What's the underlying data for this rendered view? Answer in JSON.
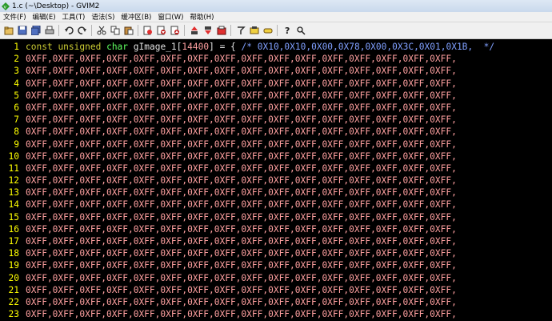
{
  "window": {
    "title": "1.c (~\\Desktop) - GVIM2"
  },
  "menu": [
    "文件(F)",
    "编辑(E)",
    "工具(T)",
    "语法(S)",
    "缓冲区(B)",
    "窗口(W)",
    "帮助(H)"
  ],
  "toolbar": [
    {
      "name": "open-icon"
    },
    {
      "name": "save-icon"
    },
    {
      "name": "save-all-icon"
    },
    {
      "name": "print-icon"
    },
    {
      "sep": true
    },
    {
      "name": "undo-icon"
    },
    {
      "name": "redo-icon"
    },
    {
      "sep": true
    },
    {
      "name": "cut-icon"
    },
    {
      "name": "copy-icon"
    },
    {
      "name": "paste-icon"
    },
    {
      "sep": true
    },
    {
      "name": "find-replace-icon"
    },
    {
      "name": "find-next-icon"
    },
    {
      "name": "find-prev-icon"
    },
    {
      "sep": true
    },
    {
      "name": "load-session-icon"
    },
    {
      "name": "save-session-icon"
    },
    {
      "name": "run-script-icon"
    },
    {
      "sep": true
    },
    {
      "name": "make-icon"
    },
    {
      "name": "shell-icon"
    },
    {
      "name": "tags-icon"
    },
    {
      "sep": true
    },
    {
      "name": "help-icon"
    },
    {
      "name": "find-help-icon"
    }
  ],
  "editor": {
    "line1": {
      "num": "1",
      "kw1": "const",
      "kw2": "unsigned",
      "kw3": "char",
      "ident": "gImage_1",
      "size": "14400",
      "assign": "] = { ",
      "comment": "/* 0X10,0X10,0X00,0X78,0X00,0X3C,0X01,0X1B,  */"
    },
    "row_text": "0XFF,0XFF,0XFF,0XFF,0XFF,0XFF,0XFF,0XFF,0XFF,0XFF,0XFF,0XFF,0XFF,0XFF,0XFF,0XFF,",
    "line_numbers": [
      "2",
      "3",
      "4",
      "5",
      "6",
      "7",
      "8",
      "9",
      "10",
      "11",
      "12",
      "13",
      "14",
      "15",
      "16",
      "17",
      "18",
      "19",
      "20",
      "21",
      "22",
      "23"
    ]
  }
}
